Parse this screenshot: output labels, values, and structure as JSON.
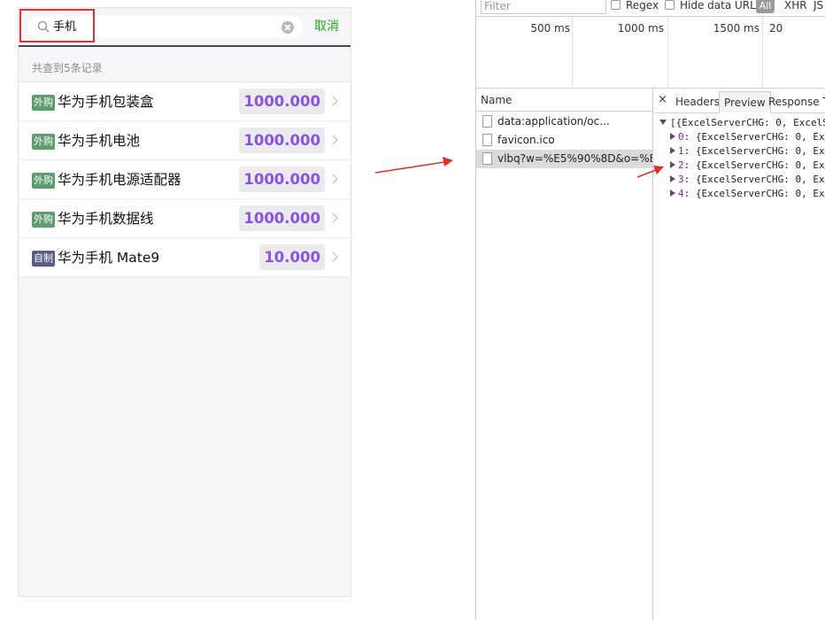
{
  "search": {
    "value": "手机",
    "cancel_label": "取消"
  },
  "results": {
    "count_text": "共查到5条记录",
    "items": [
      {
        "tag": "外购",
        "tag_type": "outsourced",
        "name": "华为手机包装盒",
        "price": "1000.000"
      },
      {
        "tag": "外购",
        "tag_type": "outsourced",
        "name": "华为手机电池",
        "price": "1000.000"
      },
      {
        "tag": "外购",
        "tag_type": "outsourced",
        "name": "华为手机电源适配器",
        "price": "1000.000"
      },
      {
        "tag": "外购",
        "tag_type": "outsourced",
        "name": "华为手机数据线",
        "price": "1000.000"
      },
      {
        "tag": "自制",
        "tag_type": "homemade",
        "name": "华为手机 Mate9",
        "price": "10.000"
      }
    ]
  },
  "devtools": {
    "filter_placeholder": "Filter",
    "regex_label": "Regex",
    "hide_data_urls_label": "Hide data URLs",
    "all_label": "All",
    "xhr_label": "XHR",
    "js_label": "JS",
    "timeline_ticks": [
      "500 ms",
      "1000 ms",
      "1500 ms",
      "20"
    ],
    "name_column": "Name",
    "requests": [
      {
        "name": "data:application/oc...",
        "selected": false
      },
      {
        "name": "favicon.ico",
        "selected": false
      },
      {
        "name": "vlbq?w=%E5%90%8D&o=%E5...",
        "selected": true
      }
    ],
    "close_symbol": "×",
    "tabs": [
      "Headers",
      "Preview",
      "Response",
      "T"
    ],
    "active_tab": "Preview",
    "preview_root": "[{ExcelServerCHG: 0, ExcelS",
    "preview_items": [
      {
        "index": "0",
        "text": ": {ExcelServerCHG: 0, Exc"
      },
      {
        "index": "1",
        "text": ": {ExcelServerCHG: 0, Exc"
      },
      {
        "index": "2",
        "text": ": {ExcelServerCHG: 0, Exc"
      },
      {
        "index": "3",
        "text": ": {ExcelServerCHG: 0, Exc"
      },
      {
        "index": "4",
        "text": ": {ExcelServerCHG: 0, Exc"
      }
    ]
  },
  "colors": {
    "accent_green": "#1aad19",
    "price_purple": "#8a53e8",
    "highlight_red": "#e03131"
  }
}
